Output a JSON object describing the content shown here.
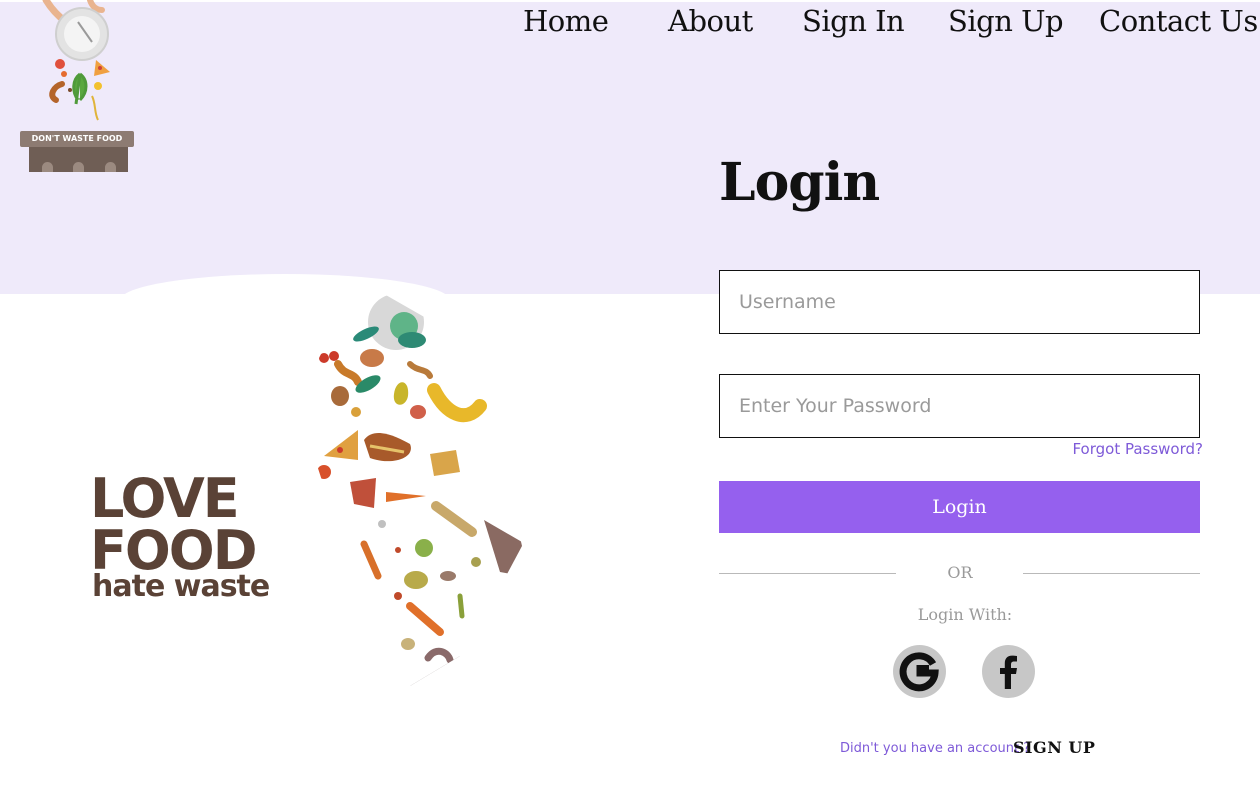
{
  "nav": {
    "items": [
      {
        "label": "Home"
      },
      {
        "label": "About"
      },
      {
        "label": "Sign In"
      },
      {
        "label": "Sign Up"
      },
      {
        "label": "Contact Us"
      }
    ]
  },
  "logo": {
    "sign_text": "DON'T WASTE FOOD"
  },
  "brand": {
    "line1": "LOVE",
    "line2": "FOOD",
    "line3": "hate waste"
  },
  "login": {
    "title": "Login",
    "username_placeholder": "Username",
    "password_placeholder": "Enter Your Password",
    "forgot_label": "Forgot Password?",
    "button_label": "Login",
    "or_label": "OR",
    "login_with_label": "Login With:",
    "social": [
      {
        "name": "google-icon",
        "glyph": "G"
      },
      {
        "name": "facebook-icon",
        "glyph": "f"
      }
    ],
    "no_account_text": "Didn't you have an account ?",
    "signup_label": "SIGN UP"
  },
  "colors": {
    "accent": "#9560ee",
    "link": "#7e5ad8",
    "band": "#efeafa",
    "brand_brown": "#5a4236"
  }
}
